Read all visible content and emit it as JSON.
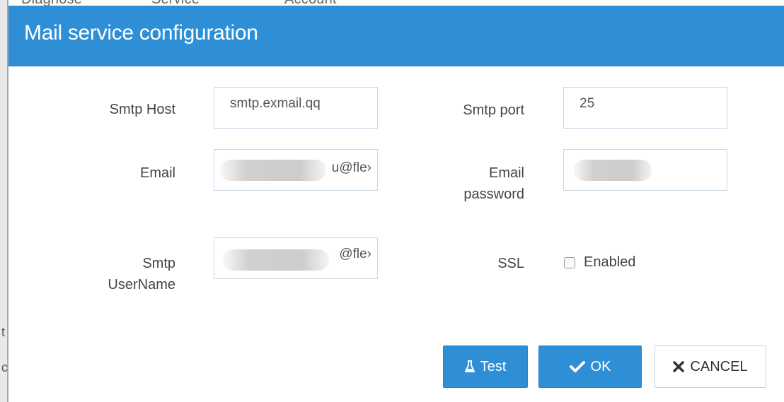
{
  "background": {
    "nav_items": [
      "Diagnose",
      "Service",
      "Account"
    ],
    "left_letters": [
      "t",
      "c"
    ]
  },
  "dialog": {
    "title": "Mail service configuration",
    "fields": {
      "smtp_host": {
        "label": "Smtp Host",
        "value": "smtp.exmail.qq"
      },
      "smtp_port": {
        "label": "Smtp port",
        "value": "25"
      },
      "email": {
        "label_line1": "Email",
        "value_suffix": "u@fle›"
      },
      "email_password": {
        "label_line1": "Email",
        "label_line2": "password",
        "value": ""
      },
      "smtp_username": {
        "label_line1": "Smtp",
        "label_line2": "UserName",
        "value_suffix": "@fle›"
      },
      "ssl": {
        "label": "SSL",
        "checkbox_label": "Enabled",
        "checked": false
      }
    },
    "buttons": {
      "test": {
        "label": "Test",
        "icon": "flask-icon"
      },
      "ok": {
        "label": "OK",
        "icon": "check-icon"
      },
      "cancel": {
        "label": "CANCEL",
        "icon": "close-icon"
      }
    }
  },
  "colors": {
    "header": "#2e8fd6",
    "primary_button": "#2e8fd6",
    "input_border": "#c8d7e6"
  }
}
